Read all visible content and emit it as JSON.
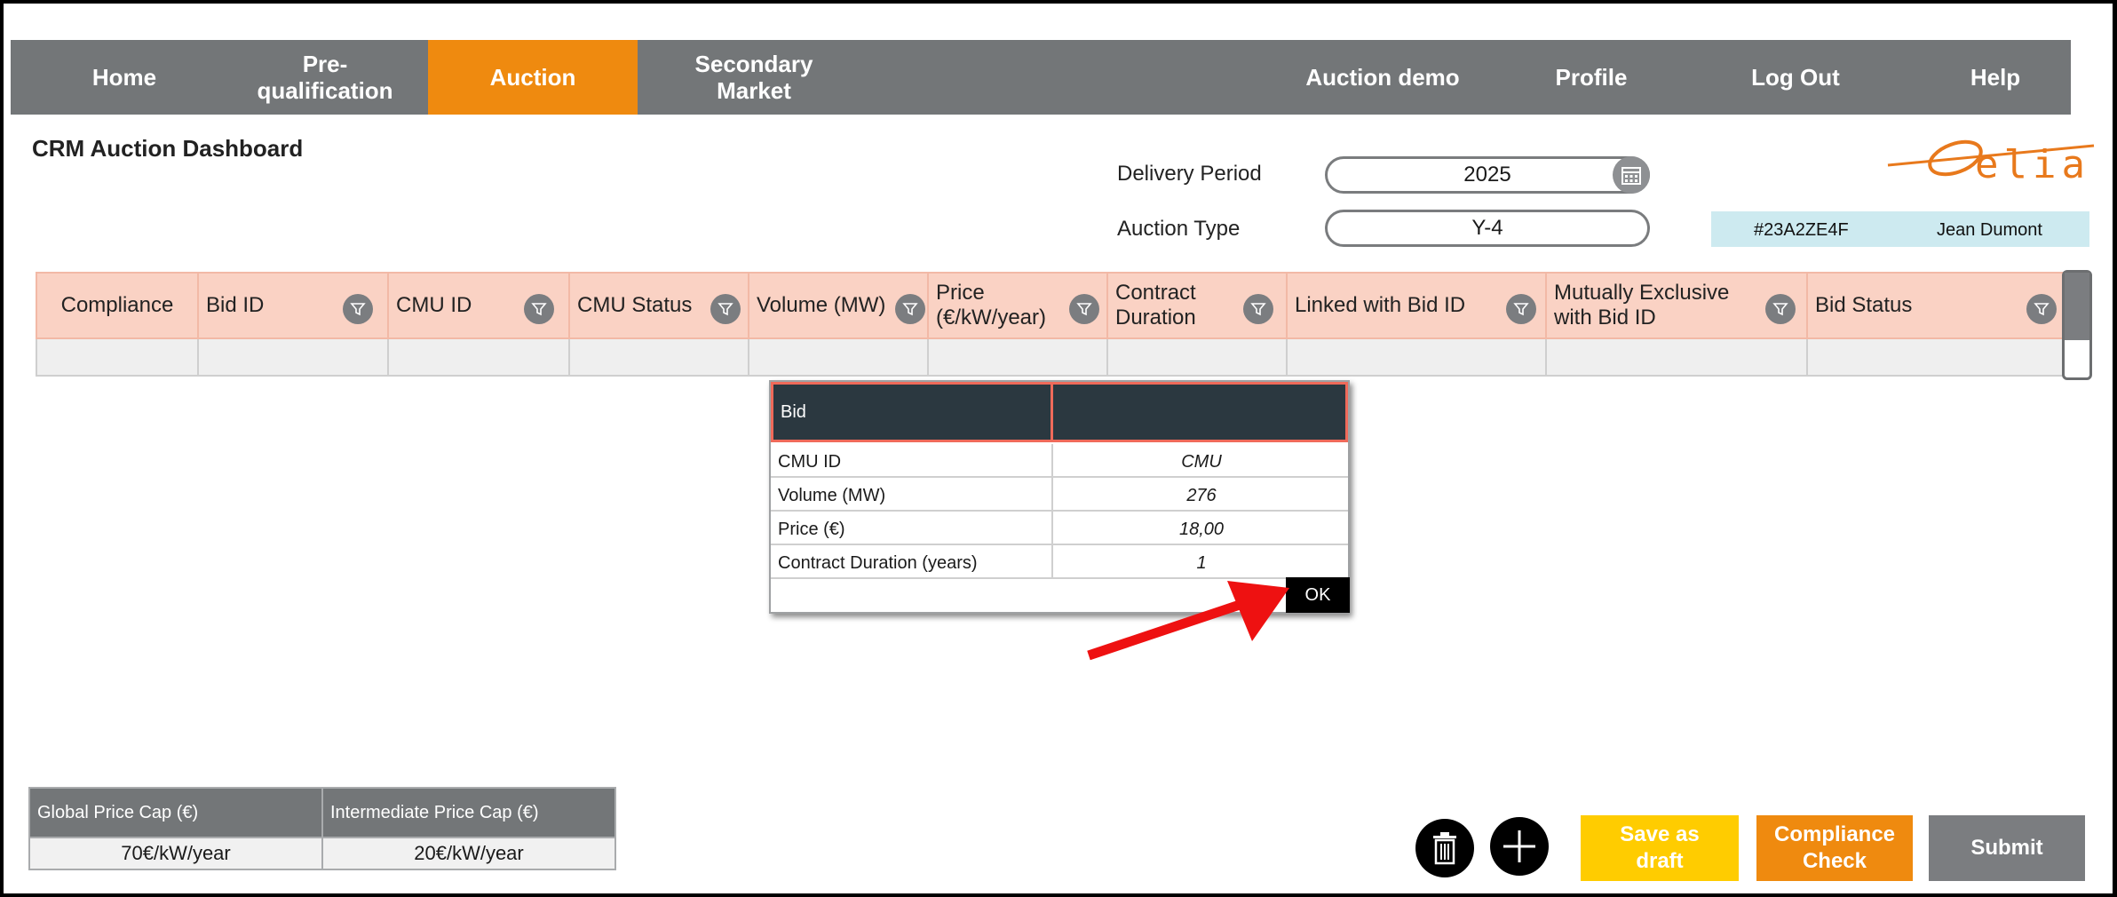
{
  "nav": {
    "items": [
      {
        "label": "Home"
      },
      {
        "label": "Pre-\nqualification"
      },
      {
        "label": "Auction"
      },
      {
        "label": "Secondary\nMarket"
      },
      {
        "label": "Auction demo"
      },
      {
        "label": "Profile"
      },
      {
        "label": "Log Out"
      },
      {
        "label": "Help"
      }
    ],
    "active": "Auction",
    "active_color": "#ef8a0f",
    "bar_color": "#737678"
  },
  "page": {
    "title": "CRM Auction Dashboard"
  },
  "filters": {
    "delivery_period_label": "Delivery Period",
    "delivery_period_value": "2025",
    "auction_type_label": "Auction Type",
    "auction_type_value": "Y-4"
  },
  "user": {
    "id": "#23A2ZE4F",
    "name": "Jean Dumont"
  },
  "logo": {
    "text": "elia",
    "color": "#e8791c"
  },
  "table": {
    "columns": [
      {
        "label": "Compliance"
      },
      {
        "label": "Bid ID"
      },
      {
        "label": "CMU ID"
      },
      {
        "label": "CMU Status"
      },
      {
        "label": "Volume (MW)"
      },
      {
        "label": "Price\n(€/kW/year)"
      },
      {
        "label": "Contract\nDuration"
      },
      {
        "label": "Linked with Bid ID"
      },
      {
        "label": "Mutually Exclusive\nwith Bid ID"
      },
      {
        "label": "Bid Status"
      }
    ],
    "header_color": "#fad2c4"
  },
  "popup": {
    "header": "Bid",
    "rows": [
      {
        "key": "CMU ID",
        "value": "CMU"
      },
      {
        "key": "Volume (MW)",
        "value": "276"
      },
      {
        "key": "Price (€)",
        "value": "18,00"
      },
      {
        "key": "Contract Duration (years)",
        "value": "1"
      }
    ],
    "ok_label": "OK"
  },
  "caps": {
    "global_label": "Global Price Cap (€)",
    "global_value": "70€/kW/year",
    "intermediate_label": "Intermediate Price Cap (€)",
    "intermediate_value": "20€/kW/year"
  },
  "actions": {
    "delete_icon": "trash-icon",
    "add_icon": "plus-icon",
    "save_draft_label": "Save as\ndraft",
    "save_draft_color": "#ffcc00",
    "compliance_label": "Compliance\nCheck",
    "compliance_color": "#ef8a0f",
    "submit_label": "Submit",
    "submit_color": "#7b7d80"
  }
}
